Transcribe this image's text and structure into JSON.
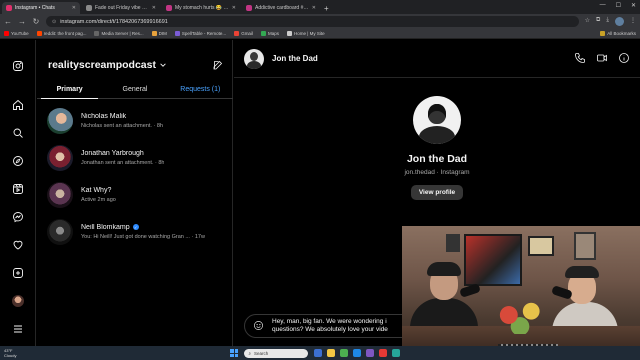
{
  "browser": {
    "tabs": [
      {
        "title": "Instagram • Chats",
        "active": true,
        "color": "#e1306c"
      },
      {
        "title": "Fade out Friday vibe 🍻🍺 #fri",
        "active": false,
        "color": "#8a8a8a"
      },
      {
        "title": "My stomach hurts 😂 | Instag",
        "active": false,
        "color": "#c13584"
      },
      {
        "title": "Addictive cardboard #pokemo",
        "active": false,
        "color": "#c13584"
      }
    ],
    "new_tab": "+",
    "url": "instagram.com/direct/t/17842067369916691",
    "bookmarks": [
      {
        "label": "YouTube",
        "color": "#ff0000"
      },
      {
        "label": "reddit: the front pag...",
        "color": "#ff4500"
      },
      {
        "label": "Media Server | Res...",
        "color": "#666666"
      },
      {
        "label": "DIM",
        "color": "#e8a33d"
      },
      {
        "label": "SpellTable - Remote...",
        "color": "#7b5cd6"
      },
      {
        "label": "Gmail",
        "color": "#ea4335"
      },
      {
        "label": "Maps",
        "color": "#34a853"
      },
      {
        "label": "Home | My Site",
        "color": "#cccccc"
      }
    ],
    "all_bookmarks": "All Bookmarks"
  },
  "inbox": {
    "account": "realityscreampodcast",
    "tabs": [
      {
        "label": "Primary",
        "active": true
      },
      {
        "label": "General",
        "active": false
      },
      {
        "label": "Requests (1)",
        "active": false
      }
    ],
    "conversations": [
      {
        "name": "Nicholas Malik",
        "preview": "Nicholas sent an attachment. · 8h",
        "verified": false
      },
      {
        "name": "Jonathan Yarbrough",
        "preview": "Jonathan sent an attachment. · 8h",
        "verified": false
      },
      {
        "name": "Kat Why?",
        "preview": "Active 2m ago",
        "verified": false
      },
      {
        "name": "Neill Blomkamp",
        "preview": "You: Hi Neill! Just got done watching Gran ... · 17w",
        "verified": true
      }
    ]
  },
  "thread": {
    "name": "Jon the Dad",
    "profile_name": "Jon the Dad",
    "profile_sub": "jon.thedad · Instagram",
    "view_profile": "View profile",
    "message_draft": "Hey, man, big fan. We were wondering i\nquestions? We absolutely love your vide"
  },
  "taskbar": {
    "temp": "43°F",
    "condition": "Cloudy",
    "search": "Search"
  },
  "colors": {
    "background": "#000000",
    "link_blue": "#4aa3ff",
    "verified_blue": "#2e8bff",
    "muted_text": "#a8a8a8"
  }
}
